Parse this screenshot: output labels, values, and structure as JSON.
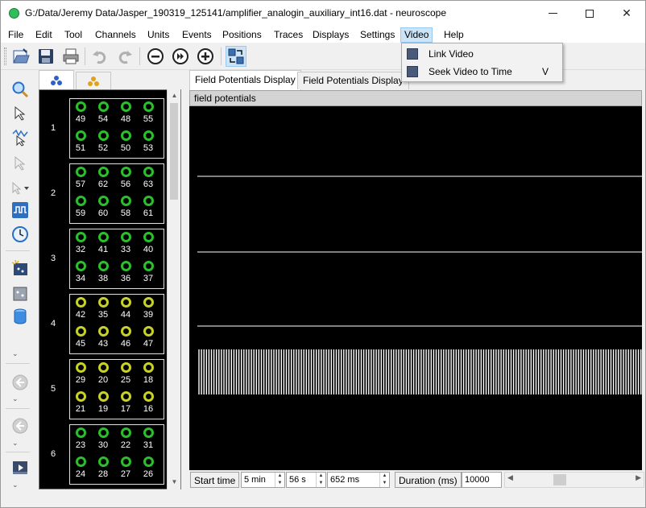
{
  "window": {
    "title": "G:/Data/Jeremy Data/Jasper_190319_125141/amplifier_analogin_auxiliary_int16.dat - neuroscope"
  },
  "menubar": {
    "items": [
      "File",
      "Edit",
      "Tool",
      "Channels",
      "Units",
      "Events",
      "Positions",
      "Traces",
      "Displays",
      "Settings",
      "Video",
      "Help"
    ],
    "active": "Video"
  },
  "video_menu": {
    "items": [
      {
        "label": "Link Video",
        "shortcut": ""
      },
      {
        "label": "Seek Video to Time",
        "shortcut": "V"
      }
    ]
  },
  "toolbar": {
    "icons": [
      "open-file-icon",
      "save-icon",
      "print-icon",
      "undo-icon",
      "redo-icon",
      "remove-channel-icon",
      "advance-icon",
      "add-channel-icon",
      "show-hide-icon"
    ]
  },
  "channel_panel": {
    "tabs": [
      "spike-groups-icon",
      "anatomical-groups-icon"
    ],
    "groups": [
      {
        "num": "1",
        "color": "green",
        "top": [
          "49",
          "54",
          "48",
          "55"
        ],
        "bottom": [
          "51",
          "52",
          "50",
          "53"
        ]
      },
      {
        "num": "2",
        "color": "green",
        "top": [
          "57",
          "62",
          "56",
          "63"
        ],
        "bottom": [
          "59",
          "60",
          "58",
          "61"
        ]
      },
      {
        "num": "3",
        "color": "green",
        "top": [
          "32",
          "41",
          "33",
          "40"
        ],
        "bottom": [
          "34",
          "38",
          "36",
          "37"
        ]
      },
      {
        "num": "4",
        "color": "yellow",
        "top": [
          "42",
          "35",
          "44",
          "39"
        ],
        "bottom": [
          "45",
          "43",
          "46",
          "47"
        ]
      },
      {
        "num": "5",
        "color": "yellow",
        "top": [
          "29",
          "20",
          "25",
          "18"
        ],
        "bottom": [
          "21",
          "19",
          "17",
          "16"
        ]
      },
      {
        "num": "6",
        "color": "green",
        "top": [
          "23",
          "30",
          "22",
          "31"
        ],
        "bottom": [
          "24",
          "28",
          "27",
          "26"
        ]
      }
    ]
  },
  "display_tabs": [
    "Field Potentials Display",
    "Field Potentials Display"
  ],
  "field_potentials": {
    "header": "field potentials"
  },
  "bottom_bar": {
    "start_time_label": "Start time",
    "minutes": "5 min",
    "seconds": "56 s",
    "milliseconds": "652 ms",
    "duration_label": "Duration (ms)",
    "duration_value": "10000"
  },
  "colors": {
    "group_green": "#2cbf2c",
    "group_yellow": "#c8d12a",
    "trace": "#ffffff",
    "menu_highlight": "#cce4f7"
  }
}
